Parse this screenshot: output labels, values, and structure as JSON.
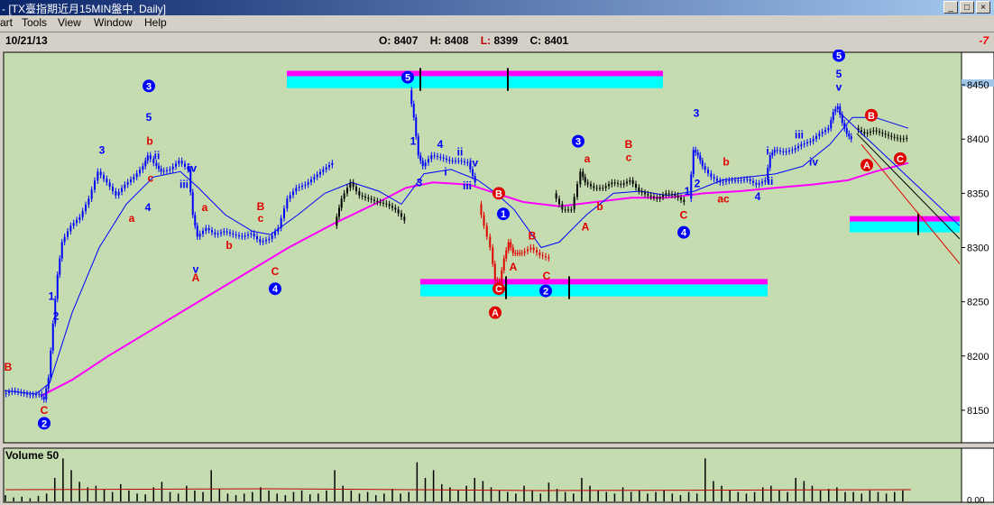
{
  "window": {
    "title": "- [TX臺指期近月15MIN盤中, Daily]",
    "buttons": [
      "_",
      "□",
      "×"
    ]
  },
  "menu": {
    "items": [
      "art",
      "Tools",
      "View",
      "Window",
      "Help"
    ]
  },
  "info": {
    "date": "10/21/13",
    "open_label": "O:",
    "open": "8407",
    "high_label": "H:",
    "high": "8408",
    "low_label": "L:",
    "low": "8399",
    "close_label": "C:",
    "close": "8401",
    "right_value": "-7"
  },
  "colors": {
    "chart_bg": "#c4dcb0",
    "panel_bg": "#ffffff",
    "ma_fast": "#0000ff",
    "ma_slow": "#ff00ff",
    "candle": "#000000",
    "wave_blue": "#0000ff",
    "wave_red": "#e00000",
    "band_cyan": "#00ffff",
    "band_magenta": "#ff00ff"
  },
  "chart_data": {
    "type": "candlestick",
    "y_ticks": [
      "8450",
      "8400",
      "8350",
      "8300",
      "8250",
      "8200",
      "8150"
    ],
    "ylim": [
      8120,
      8480
    ],
    "volume_label": "Volume 50",
    "volume_tick": "0.00",
    "segments": [
      {
        "c": "#0000ff",
        "pts": [
          [
            5,
            8165
          ],
          [
            15,
            8168
          ],
          [
            25,
            8166
          ],
          [
            35,
            8164
          ],
          [
            45,
            8165
          ],
          [
            50,
            8160
          ],
          [
            55,
            8180
          ],
          [
            60,
            8230
          ],
          [
            65,
            8275
          ],
          [
            70,
            8305
          ],
          [
            80,
            8320
          ],
          [
            90,
            8328
          ],
          [
            100,
            8345
          ],
          [
            110,
            8370
          ],
          [
            120,
            8360
          ],
          [
            130,
            8348
          ],
          [
            140,
            8358
          ],
          [
            150,
            8365
          ],
          [
            160,
            8375
          ],
          [
            165,
            8385
          ],
          [
            172,
            8378
          ],
          [
            180,
            8370
          ],
          [
            190,
            8372
          ],
          [
            200,
            8380
          ],
          [
            210,
            8372
          ],
          [
            215,
            8330
          ],
          [
            220,
            8310
          ],
          [
            230,
            8318
          ],
          [
            240,
            8312
          ],
          [
            250,
            8315
          ],
          [
            260,
            8312
          ],
          [
            270,
            8310
          ],
          [
            280,
            8313
          ],
          [
            290,
            8305
          ],
          [
            300,
            8308
          ],
          [
            310,
            8318
          ],
          [
            320,
            8345
          ],
          [
            330,
            8355
          ],
          [
            340,
            8358
          ],
          [
            350,
            8365
          ],
          [
            360,
            8372
          ],
          [
            370,
            8378
          ]
        ]
      },
      {
        "c": "#000000",
        "pts": [
          [
            372,
            8320
          ],
          [
            380,
            8345
          ],
          [
            390,
            8360
          ],
          [
            400,
            8348
          ],
          [
            410,
            8345
          ],
          [
            420,
            8342
          ],
          [
            430,
            8340
          ],
          [
            440,
            8335
          ],
          [
            450,
            8325
          ]
        ]
      },
      {
        "c": "#0000ff",
        "pts": [
          [
            455,
            8445
          ],
          [
            460,
            8420
          ],
          [
            465,
            8385
          ],
          [
            470,
            8375
          ],
          [
            480,
            8385
          ],
          [
            490,
            8383
          ],
          [
            500,
            8380
          ],
          [
            510,
            8380
          ],
          [
            520,
            8378
          ],
          [
            528,
            8360
          ]
        ]
      },
      {
        "c": "#e00000",
        "pts": [
          [
            532,
            8340
          ],
          [
            538,
            8320
          ],
          [
            545,
            8300
          ],
          [
            550,
            8270
          ],
          [
            555,
            8268
          ],
          [
            560,
            8290
          ],
          [
            565,
            8305
          ],
          [
            570,
            8295
          ],
          [
            575,
            8295
          ],
          [
            580,
            8295
          ],
          [
            590,
            8300
          ],
          [
            600,
            8293
          ],
          [
            610,
            8290
          ]
        ]
      },
      {
        "c": "#000000",
        "pts": [
          [
            615,
            8350
          ],
          [
            625,
            8335
          ],
          [
            635,
            8335
          ],
          [
            645,
            8370
          ],
          [
            650,
            8360
          ],
          [
            660,
            8355
          ],
          [
            670,
            8355
          ],
          [
            680,
            8360
          ],
          [
            690,
            8358
          ],
          [
            700,
            8362
          ],
          [
            710,
            8352
          ],
          [
            720,
            8348
          ],
          [
            730,
            8345
          ],
          [
            740,
            8350
          ],
          [
            750,
            8348
          ],
          [
            760,
            8342
          ]
        ]
      },
      {
        "c": "#0000ff",
        "pts": [
          [
            765,
            8345
          ],
          [
            770,
            8390
          ],
          [
            775,
            8385
          ],
          [
            780,
            8375
          ],
          [
            790,
            8365
          ],
          [
            800,
            8360
          ],
          [
            810,
            8362
          ],
          [
            820,
            8362
          ],
          [
            830,
            8363
          ],
          [
            840,
            8358
          ],
          [
            850,
            8362
          ],
          [
            855,
            8385
          ],
          [
            860,
            8390
          ],
          [
            870,
            8388
          ],
          [
            880,
            8390
          ],
          [
            890,
            8395
          ],
          [
            900,
            8398
          ],
          [
            910,
            8405
          ],
          [
            920,
            8410
          ],
          [
            925,
            8425
          ],
          [
            930,
            8430
          ],
          [
            935,
            8415
          ],
          [
            940,
            8405
          ],
          [
            945,
            8400
          ]
        ]
      },
      {
        "c": "#000000",
        "pts": [
          [
            950,
            8410
          ],
          [
            960,
            8405
          ],
          [
            970,
            8408
          ],
          [
            980,
            8405
          ],
          [
            990,
            8402
          ],
          [
            1000,
            8400
          ],
          [
            1007,
            8401
          ]
        ]
      }
    ],
    "ma_fast": [
      [
        5,
        8168
      ],
      [
        40,
        8165
      ],
      [
        55,
        8175
      ],
      [
        80,
        8240
      ],
      [
        110,
        8300
      ],
      [
        140,
        8340
      ],
      [
        170,
        8365
      ],
      [
        200,
        8370
      ],
      [
        220,
        8355
      ],
      [
        250,
        8330
      ],
      [
        280,
        8315
      ],
      [
        300,
        8312
      ],
      [
        330,
        8330
      ],
      [
        360,
        8350
      ],
      [
        390,
        8360
      ],
      [
        420,
        8352
      ],
      [
        445,
        8340
      ],
      [
        470,
        8368
      ],
      [
        500,
        8372
      ],
      [
        530,
        8362
      ],
      [
        550,
        8350
      ],
      [
        570,
        8335
      ],
      [
        600,
        8300
      ],
      [
        620,
        8305
      ],
      [
        650,
        8330
      ],
      [
        680,
        8350
      ],
      [
        710,
        8352
      ],
      [
        740,
        8348
      ],
      [
        770,
        8352
      ],
      [
        800,
        8362
      ],
      [
        830,
        8365
      ],
      [
        860,
        8368
      ],
      [
        890,
        8375
      ],
      [
        920,
        8395
      ],
      [
        945,
        8420
      ],
      [
        970,
        8420
      ],
      [
        1007,
        8410
      ]
    ],
    "ma_slow": [
      [
        45,
        8163
      ],
      [
        80,
        8178
      ],
      [
        120,
        8200
      ],
      [
        170,
        8225
      ],
      [
        220,
        8250
      ],
      [
        270,
        8275
      ],
      [
        320,
        8300
      ],
      [
        370,
        8322
      ],
      [
        420,
        8342
      ],
      [
        450,
        8355
      ],
      [
        480,
        8360
      ],
      [
        520,
        8358
      ],
      [
        550,
        8350
      ],
      [
        580,
        8342
      ],
      [
        620,
        8338
      ],
      [
        660,
        8342
      ],
      [
        700,
        8346
      ],
      [
        740,
        8346
      ],
      [
        780,
        8350
      ],
      [
        820,
        8352
      ],
      [
        860,
        8355
      ],
      [
        900,
        8358
      ],
      [
        940,
        8362
      ],
      [
        970,
        8370
      ],
      [
        1007,
        8378
      ]
    ],
    "bands": [
      {
        "x1": 318,
        "x2": 735,
        "y1": 8447,
        "y2": 8458,
        "ticks": [
          466,
          563
        ]
      },
      {
        "x1": 466,
        "x2": 851,
        "y1": 8255,
        "y2": 8266,
        "ticks": [
          561,
          631
        ]
      },
      {
        "x1": 942,
        "x2": 1064,
        "y1": 8314,
        "y2": 8324,
        "ticks": [
          1018
        ]
      }
    ],
    "channel": [
      {
        "c": "#0000ff",
        "x1": 930,
        "y1": 8425,
        "x2": 1064,
        "y2": 8320
      },
      {
        "c": "#000000",
        "x1": 950,
        "y1": 8405,
        "x2": 1064,
        "y2": 8308
      },
      {
        "c": "#e00000",
        "x1": 955,
        "y1": 8395,
        "x2": 1064,
        "y2": 8285
      }
    ],
    "annotations": [
      {
        "t": "B",
        "x": 9,
        "y": 8190,
        "c": "r"
      },
      {
        "t": "C",
        "x": 49,
        "y": 8150,
        "c": "r"
      },
      {
        "t": "2",
        "x": 49,
        "y": 8138,
        "c": "b",
        "circ": true
      },
      {
        "t": "1",
        "x": 57,
        "y": 8255,
        "c": "b"
      },
      {
        "t": "2",
        "x": 62,
        "y": 8237,
        "c": "b"
      },
      {
        "t": "3",
        "x": 113,
        "y": 8390,
        "c": "b"
      },
      {
        "t": "a",
        "x": 146,
        "y": 8327,
        "c": "r"
      },
      {
        "t": "3",
        "x": 165,
        "y": 8449,
        "c": "b",
        "circ": true
      },
      {
        "t": "5",
        "x": 165,
        "y": 8420,
        "c": "b"
      },
      {
        "t": "b",
        "x": 166,
        "y": 8398,
        "c": "r"
      },
      {
        "t": "ii",
        "x": 174,
        "y": 8385,
        "c": "b"
      },
      {
        "t": "c",
        "x": 167,
        "y": 8364,
        "c": "r"
      },
      {
        "t": "4",
        "x": 164,
        "y": 8337,
        "c": "b"
      },
      {
        "t": "iv",
        "x": 213,
        "y": 8373,
        "c": "b"
      },
      {
        "t": "iii",
        "x": 204,
        "y": 8358,
        "c": "b"
      },
      {
        "t": "a",
        "x": 227,
        "y": 8337,
        "c": "r"
      },
      {
        "t": "b",
        "x": 254,
        "y": 8302,
        "c": "r"
      },
      {
        "t": "v",
        "x": 217,
        "y": 8280,
        "c": "b"
      },
      {
        "t": "A",
        "x": 217,
        "y": 8272,
        "c": "r"
      },
      {
        "t": "B",
        "x": 289,
        "y": 8338,
        "c": "r"
      },
      {
        "t": "c",
        "x": 289,
        "y": 8327,
        "c": "r"
      },
      {
        "t": "C",
        "x": 305,
        "y": 8278,
        "c": "r"
      },
      {
        "t": "4",
        "x": 305,
        "y": 8262,
        "c": "b",
        "circ": true
      },
      {
        "t": "5",
        "x": 452,
        "y": 8457,
        "c": "b",
        "circ": true
      },
      {
        "t": "1",
        "x": 458,
        "y": 8398,
        "c": "b"
      },
      {
        "t": "3",
        "x": 465,
        "y": 8360,
        "c": "b"
      },
      {
        "t": "4",
        "x": 488,
        "y": 8395,
        "c": "b"
      },
      {
        "t": "ii",
        "x": 510,
        "y": 8388,
        "c": "b"
      },
      {
        "t": "iv",
        "x": 525,
        "y": 8378,
        "c": "b"
      },
      {
        "t": "i",
        "x": 494,
        "y": 8370,
        "c": "b"
      },
      {
        "t": "iii",
        "x": 518,
        "y": 8357,
        "c": "b"
      },
      {
        "t": "B",
        "x": 553,
        "y": 8350,
        "c": "r",
        "circ": true
      },
      {
        "t": "1",
        "x": 558,
        "y": 8331,
        "c": "b",
        "circ": true
      },
      {
        "t": "B",
        "x": 590,
        "y": 8311,
        "c": "r"
      },
      {
        "t": "A",
        "x": 569,
        "y": 8282,
        "c": "r"
      },
      {
        "t": "C",
        "x": 606,
        "y": 8274,
        "c": "r"
      },
      {
        "t": "C",
        "x": 553,
        "y": 8262,
        "c": "r",
        "circ": true
      },
      {
        "t": "2",
        "x": 605,
        "y": 8260,
        "c": "b",
        "circ": true
      },
      {
        "t": "A",
        "x": 549,
        "y": 8240,
        "c": "r",
        "circ": true
      },
      {
        "t": "3",
        "x": 641,
        "y": 8398,
        "c": "b",
        "circ": true
      },
      {
        "t": "a",
        "x": 651,
        "y": 8382,
        "c": "r"
      },
      {
        "t": "b",
        "x": 665,
        "y": 8338,
        "c": "r"
      },
      {
        "t": "A",
        "x": 649,
        "y": 8319,
        "c": "r"
      },
      {
        "t": "B",
        "x": 697,
        "y": 8395,
        "c": "r"
      },
      {
        "t": "c",
        "x": 697,
        "y": 8383,
        "c": "r"
      },
      {
        "t": "3",
        "x": 772,
        "y": 8424,
        "c": "b"
      },
      {
        "t": "b",
        "x": 805,
        "y": 8379,
        "c": "r"
      },
      {
        "t": "2",
        "x": 773,
        "y": 8359,
        "c": "b"
      },
      {
        "t": "1",
        "x": 762,
        "y": 8352,
        "c": "b"
      },
      {
        "t": "ac",
        "x": 802,
        "y": 8345,
        "c": "r"
      },
      {
        "t": "C",
        "x": 758,
        "y": 8330,
        "c": "r"
      },
      {
        "t": "4",
        "x": 758,
        "y": 8314,
        "c": "b",
        "circ": true
      },
      {
        "t": "4",
        "x": 840,
        "y": 8347,
        "c": "b"
      },
      {
        "t": "ii",
        "x": 854,
        "y": 8361,
        "c": "b"
      },
      {
        "t": "i",
        "x": 851,
        "y": 8389,
        "c": "b"
      },
      {
        "t": "iii",
        "x": 886,
        "y": 8404,
        "c": "b"
      },
      {
        "t": "iv",
        "x": 902,
        "y": 8379,
        "c": "b"
      },
      {
        "t": "5",
        "x": 930,
        "y": 8477,
        "c": "b",
        "circ": true
      },
      {
        "t": "5",
        "x": 930,
        "y": 8460,
        "c": "b"
      },
      {
        "t": "v",
        "x": 930,
        "y": 8448,
        "c": "b"
      },
      {
        "t": "B",
        "x": 966,
        "y": 8422,
        "c": "r",
        "circ": true
      },
      {
        "t": "A",
        "x": 961,
        "y": 8376,
        "c": "r",
        "circ": true
      },
      {
        "t": "C",
        "x": 998,
        "y": 8382,
        "c": "r",
        "circ": true
      }
    ],
    "volume": [
      8,
      5,
      6,
      4,
      7,
      10,
      30,
      55,
      40,
      25,
      18,
      20,
      15,
      12,
      22,
      14,
      10,
      9,
      18,
      25,
      12,
      10,
      20,
      14,
      12,
      40,
      16,
      10,
      8,
      10,
      12,
      18,
      14,
      10,
      8,
      12,
      14,
      9,
      10,
      14,
      40,
      20,
      14,
      10,
      12,
      8,
      10,
      16,
      10,
      12,
      50,
      30,
      40,
      22,
      18,
      14,
      20,
      30,
      26,
      18,
      14,
      12,
      10,
      20,
      14,
      10,
      24,
      16,
      12,
      10,
      30,
      20,
      14,
      12,
      10,
      18,
      12,
      14,
      10,
      12,
      14,
      10,
      8,
      12,
      10,
      55,
      26,
      20,
      14,
      12,
      10,
      12,
      18,
      20,
      14,
      12,
      30,
      26,
      20,
      14,
      16,
      18,
      12,
      12,
      10,
      14,
      12,
      10,
      12,
      14
    ]
  }
}
